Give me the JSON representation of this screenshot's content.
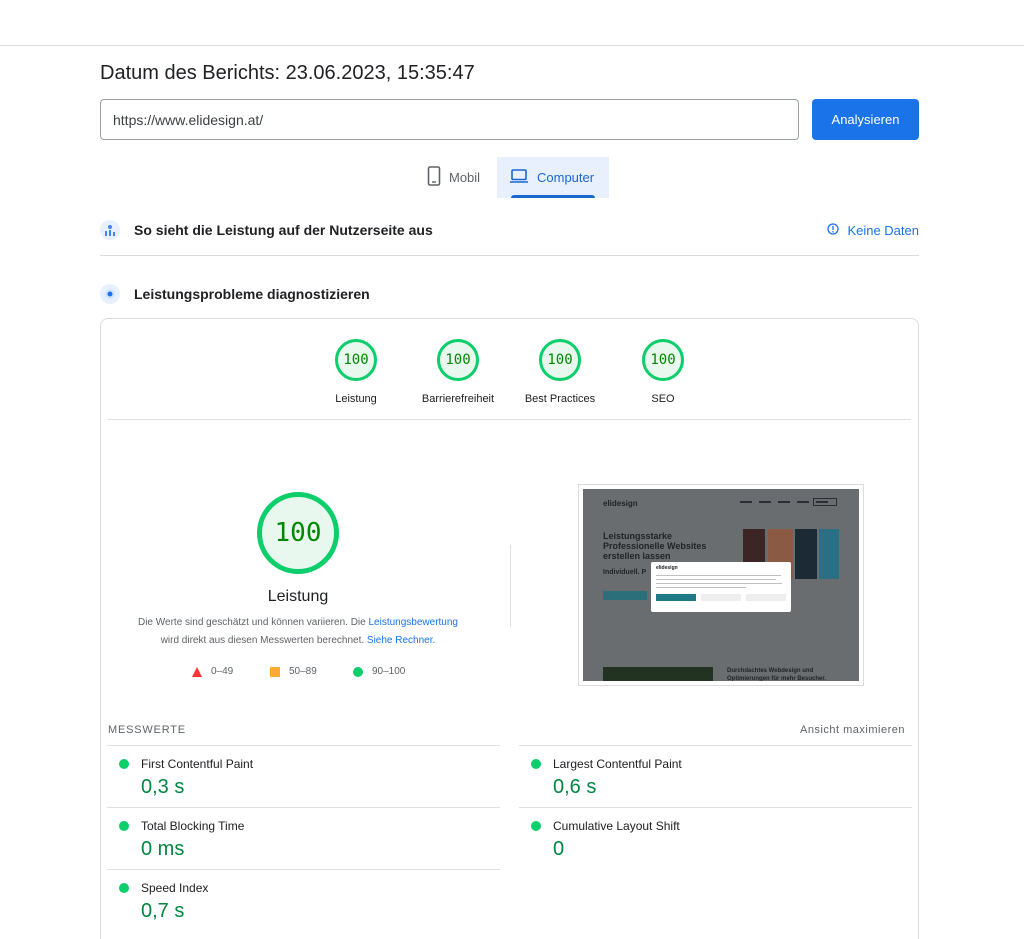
{
  "report": {
    "date_text": "Datum des Berichts: 23.06.2023, 15:35:47"
  },
  "url_field": {
    "value": "https://www.elidesign.at/"
  },
  "analyze_button": {
    "label": "Analysieren"
  },
  "device_tabs": [
    {
      "label": "Mobil",
      "icon": "phone-icon",
      "selected": false
    },
    {
      "label": "Computer",
      "icon": "laptop-icon",
      "selected": true
    }
  ],
  "field_data_section": {
    "title": "So sieht die Leistung auf der Nutzerseite aus",
    "no_data_label": "Keine Daten"
  },
  "lab_section": {
    "title": "Leistungsprobleme diagnostizieren"
  },
  "category_scores": [
    {
      "score": "100",
      "label": "Leistung"
    },
    {
      "score": "100",
      "label": "Barrierefreiheit"
    },
    {
      "score": "100",
      "label": "Best Practices"
    },
    {
      "score": "100",
      "label": "SEO"
    }
  ],
  "performance": {
    "score": "100",
    "label": "Leistung",
    "disclaimer_part1": "Die Werte sind geschätzt und können variieren. Die ",
    "disclaimer_link1": "Leistungsbewertung",
    "disclaimer_part2": " wird direkt aus diesen Messwerten berechnet. ",
    "disclaimer_link2": "Siehe Rechner."
  },
  "legend": [
    {
      "range": "0–49",
      "shape": "triangle",
      "color": "#ff3333"
    },
    {
      "range": "50–89",
      "shape": "square",
      "color": "#ffaa33"
    },
    {
      "range": "90–100",
      "shape": "circle",
      "color": "#0cce6b"
    }
  ],
  "screenshot_preview": {
    "logo": "elidesign",
    "headline": "Leistungsstarke Professionelle Websites erstellen lassen",
    "subline": "Individuell. P",
    "modal_logo": "elidesign",
    "bottom_text": "Durchdachtes Webdesign und Optimierungen für mehr Besucher."
  },
  "metrics": {
    "heading": "MESSWERTE",
    "expand_label": "Ansicht maximieren",
    "items": [
      {
        "name": "First Contentful Paint",
        "value": "0,3 s",
        "status_color": "#0cce6b"
      },
      {
        "name": "Largest Contentful Paint",
        "value": "0,6 s",
        "status_color": "#0cce6b"
      },
      {
        "name": "Total Blocking Time",
        "value": "0 ms",
        "status_color": "#0cce6b"
      },
      {
        "name": "Cumulative Layout Shift",
        "value": "0",
        "status_color": "#0cce6b"
      },
      {
        "name": "Speed Index",
        "value": "0,7 s",
        "status_color": "#0cce6b"
      }
    ]
  },
  "colors": {
    "accent": "#1a73e8",
    "pass": "#0cce6b",
    "pass_text": "#018642"
  }
}
